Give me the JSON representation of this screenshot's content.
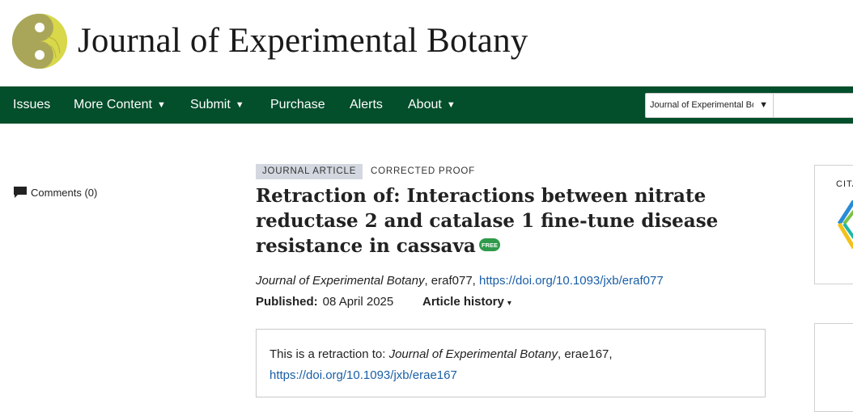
{
  "header": {
    "journal_title": "Journal of Experimental Botany",
    "logo_icon": "leaf-logo-icon"
  },
  "nav": {
    "items": [
      {
        "label": "Issues",
        "has_caret": false
      },
      {
        "label": "More Content",
        "has_caret": true
      },
      {
        "label": "Submit",
        "has_caret": true
      },
      {
        "label": "Purchase",
        "has_caret": false
      },
      {
        "label": "Alerts",
        "has_caret": false
      },
      {
        "label": "About",
        "has_caret": true
      }
    ],
    "caret": "▼",
    "search_scope": "Journal of Experimental Botany",
    "search_caret": "▼"
  },
  "sidebar": {
    "comments_label": "Comments (0)"
  },
  "article": {
    "type_badge": "JOURNAL ARTICLE",
    "status_badge": "CORRECTED PROOF",
    "title": "Retraction of: Interactions between nitrate reductase 2 and catalase 1 fine-tune disease resistance in cassava",
    "free_badge": "FREE",
    "citation_journal": "Journal of Experimental Botany",
    "citation_id": ", eraf077, ",
    "doi": "https://doi.org/10.1093/jxb/eraf077",
    "published_label": "Published:",
    "published_date": "08 April 2025",
    "history_label": "Article history",
    "history_caret": "▾",
    "retraction": {
      "prefix": "This is a retraction to: ",
      "journal": "Journal of Experimental Botany",
      "id": ", erae167,",
      "doi": "https://doi.org/10.1093/jxb/erae167"
    }
  },
  "right_panel": {
    "citations_label": "CITA"
  },
  "colors": {
    "nav_bg": "#034e2b",
    "link": "#1a5fa6",
    "badge_bg": "#d3d8e0",
    "free_badge": "#2e9a4a"
  }
}
